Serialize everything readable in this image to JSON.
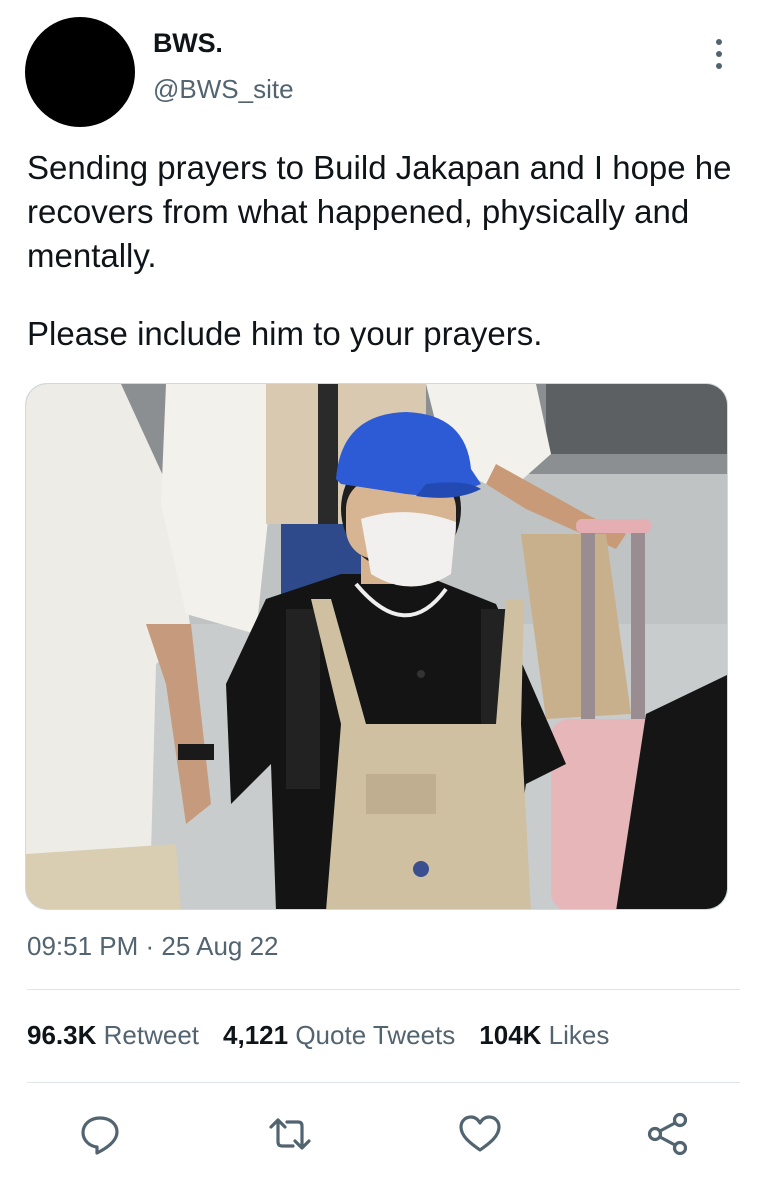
{
  "author": {
    "display_name": "BWS.",
    "handle": "@BWS_site"
  },
  "tweet": {
    "paragraphs": [
      "Sending prayers to Build Jakapan and I hope he recovers from what happened, physically and mentally.",
      "Please include him to your prayers."
    ],
    "timestamp": "09:51 PM · 25 Aug 22"
  },
  "stats": {
    "retweets_count": "96.3K",
    "retweets_label": "Retweet",
    "quotes_count": "4,121",
    "quotes_label": "Quote Tweets",
    "likes_count": "104K",
    "likes_label": "Likes"
  },
  "actions": {
    "reply_icon": "reply-icon",
    "retweet_icon": "retweet-icon",
    "like_icon": "heart-icon",
    "share_icon": "share-icon"
  },
  "colors": {
    "text_primary": "#0f1419",
    "text_secondary": "#536471",
    "divider": "#dfe5e8"
  }
}
